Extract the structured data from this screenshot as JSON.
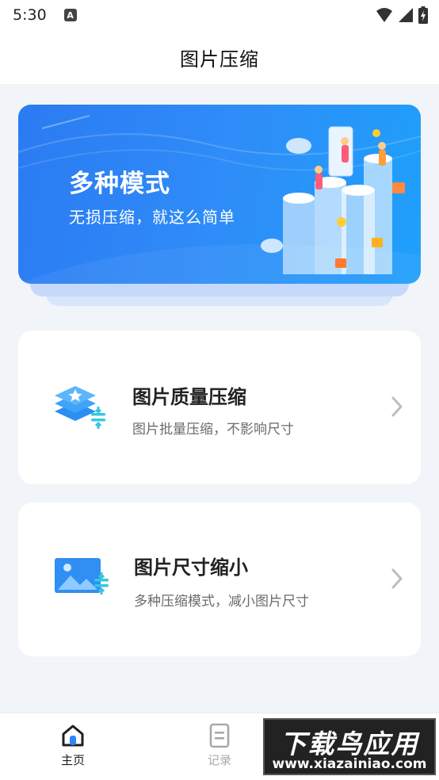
{
  "status_bar": {
    "time": "5:30",
    "notification_letter": "A"
  },
  "header": {
    "title": "图片压缩"
  },
  "banner": {
    "title": "多种模式",
    "subtitle": "无损压缩，就这么简单"
  },
  "cards": [
    {
      "title": "图片质量压缩",
      "description": "图片批量压缩，不影响尺寸",
      "icon": "layers-compress-icon"
    },
    {
      "title": "图片尺寸缩小",
      "description": "多种压缩模式，减小图片尺寸",
      "icon": "image-resize-icon"
    }
  ],
  "bottom_nav": {
    "items": [
      {
        "label": "主页",
        "icon": "home-icon",
        "active": true
      },
      {
        "label": "记录",
        "icon": "document-icon",
        "active": false
      }
    ]
  },
  "watermark": {
    "line1": "下载鸟应用",
    "line2": "www.xiazainiao.com"
  },
  "colors": {
    "accent": "#2f86f6",
    "page_bg": "#f1f4f8",
    "inactive_nav": "#a8a8a8"
  }
}
